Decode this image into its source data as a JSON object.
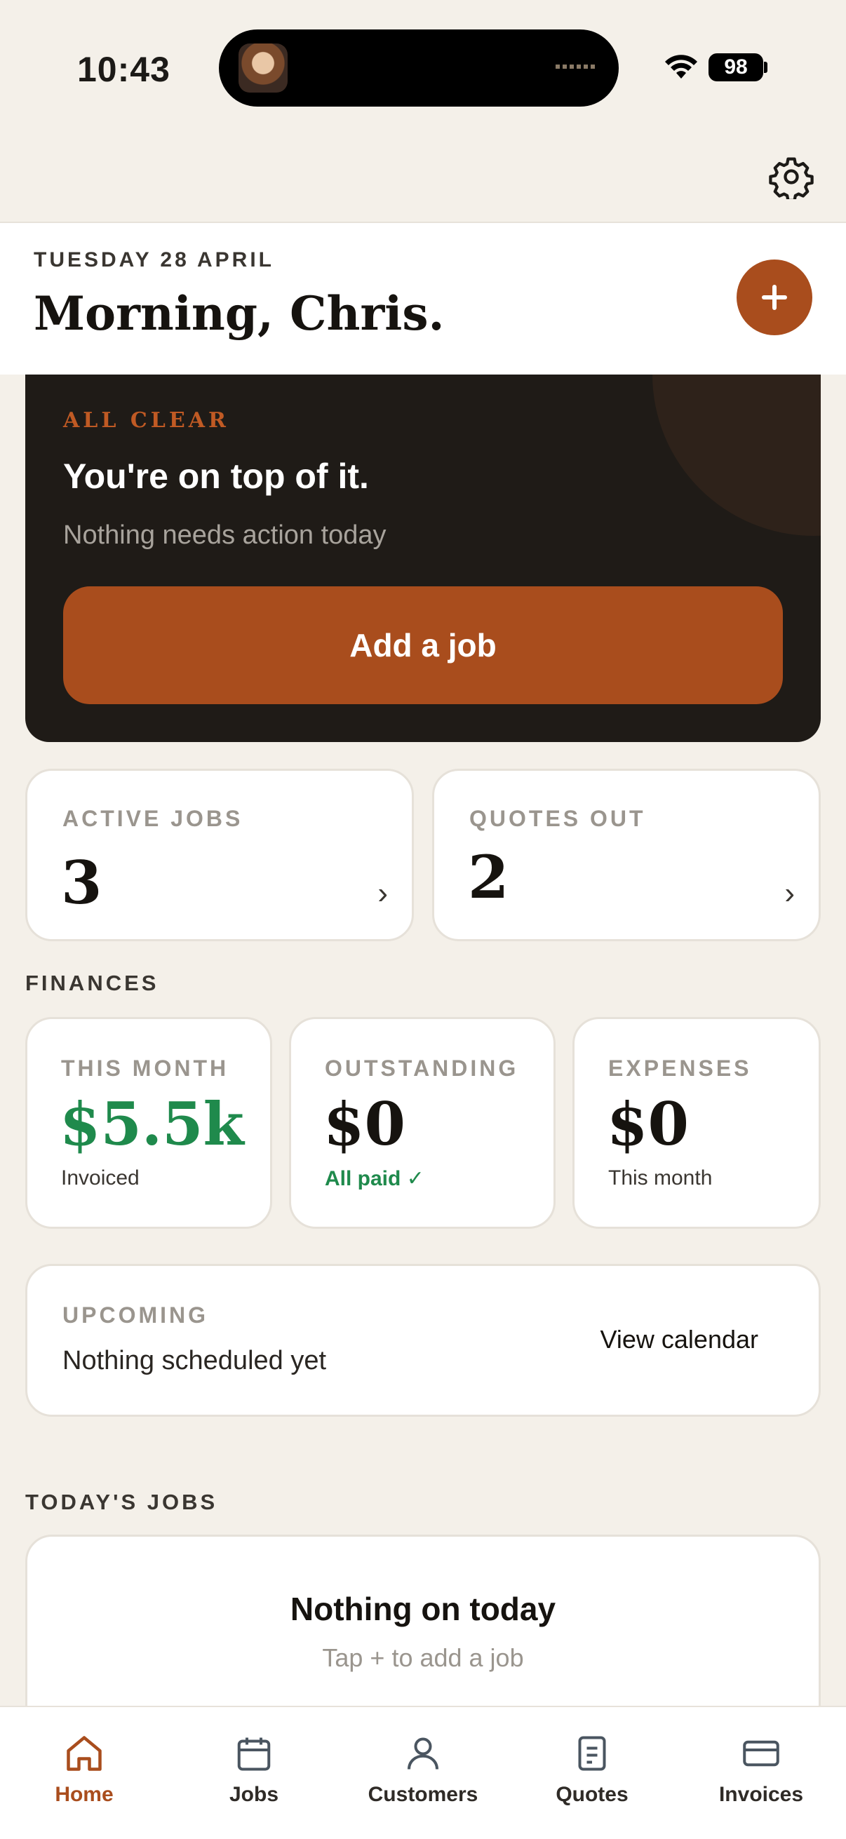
{
  "status_bar": {
    "time": "10:43",
    "battery": "98"
  },
  "header": {
    "date": "TUESDAY 28 APRIL",
    "greeting": "Morning, Chris."
  },
  "hero": {
    "kicker": "ALL CLEAR",
    "title": "You're on top of it.",
    "subtitle": "Nothing needs action today",
    "button_label": "Add a job"
  },
  "stats": [
    {
      "label": "ACTIVE JOBS",
      "value": "3"
    },
    {
      "label": "QUOTES OUT",
      "value": "2"
    }
  ],
  "finances": {
    "section_label": "FINANCES",
    "cards": [
      {
        "label": "THIS MONTH",
        "value": "$5.5k",
        "sub": "Invoiced"
      },
      {
        "label": "OUTSTANDING",
        "value": "$0",
        "sub": "All paid ✓"
      },
      {
        "label": "EXPENSES",
        "value": "$0",
        "sub": "This month"
      }
    ]
  },
  "upcoming": {
    "label": "UPCOMING",
    "text": "Nothing scheduled yet",
    "link": "View calendar"
  },
  "todays_jobs": {
    "section_label": "TODAY'S JOBS",
    "empty_title": "Nothing on today",
    "empty_sub": "Tap + to add a job"
  },
  "tabs": [
    {
      "label": "Home",
      "icon": "home-icon",
      "active": true
    },
    {
      "label": "Jobs",
      "icon": "calendar-icon"
    },
    {
      "label": "Customers",
      "icon": "person-icon"
    },
    {
      "label": "Quotes",
      "icon": "document-icon"
    },
    {
      "label": "Invoices",
      "icon": "card-icon"
    }
  ],
  "colors": {
    "accent": "#a94d1d",
    "background": "#f4f0e9",
    "hero": "#1f1b17",
    "positive": "#1f8a4c"
  }
}
